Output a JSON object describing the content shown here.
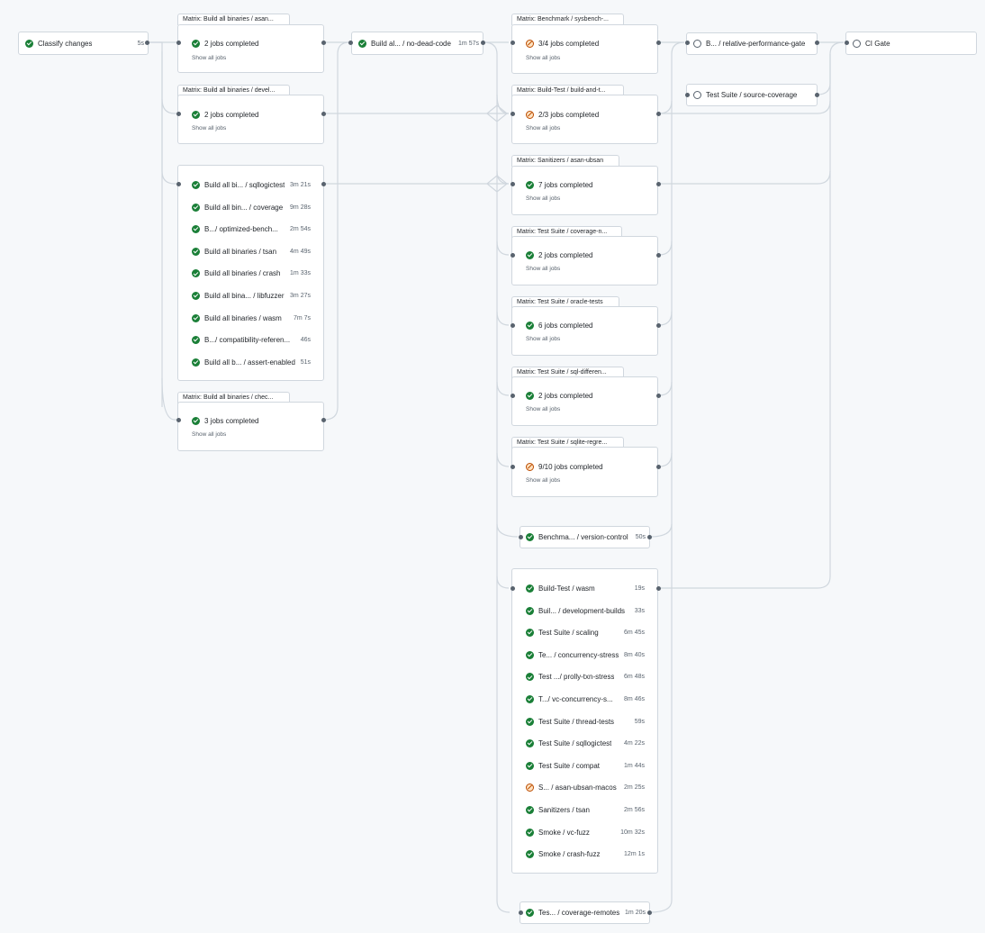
{
  "nodes": {
    "classify": {
      "label": "Classify changes",
      "duration": "5s"
    },
    "no_dead_code": {
      "label": "Build al... / no-dead-code",
      "duration": "1m 57s"
    },
    "perf_gate": {
      "label": "B... / relative-performance-gate"
    },
    "source_coverage": {
      "label": "Test Suite / source-coverage"
    },
    "ci_gate": {
      "label": "CI Gate"
    },
    "version_control": {
      "label": "Benchma... / version-control",
      "duration": "50s"
    },
    "coverage_remotes": {
      "label": "Tes... / coverage-remotes",
      "duration": "1m 20s"
    }
  },
  "show_all": "Show all jobs",
  "matrix": {
    "asan": {
      "tab": "Matrix: Build all binaries / asan...",
      "status": "2 jobs completed"
    },
    "devel": {
      "tab": "Matrix: Build all binaries / devel...",
      "status": "2 jobs completed"
    },
    "chec": {
      "tab": "Matrix: Build all binaries / chec...",
      "status": "3 jobs completed"
    },
    "sysbench": {
      "tab": "Matrix: Benchmark / sysbench-...",
      "status": "3/4 jobs completed"
    },
    "buildtest": {
      "tab": "Matrix: Build-Test / build-and-t...",
      "status": "2/3 jobs completed"
    },
    "sanitizers": {
      "tab": "Matrix: Sanitizers / asan-ubsan",
      "status": "7 jobs completed"
    },
    "coverage_n": {
      "tab": "Matrix: Test Suite / coverage-n...",
      "status": "2 jobs completed"
    },
    "oracle": {
      "tab": "Matrix: Test Suite / oracle-tests",
      "status": "6 jobs completed"
    },
    "sql_diff": {
      "tab": "Matrix: Test Suite / sql-differen...",
      "status": "2 jobs completed"
    },
    "sqlite": {
      "tab": "Matrix: Test Suite / sqlite-regre...",
      "status": "9/10 jobs completed"
    }
  },
  "build_list": [
    {
      "label": "Build all bi... / sqllogictest",
      "duration": "3m 21s"
    },
    {
      "label": "Build all bin...  / coverage",
      "duration": "9m 28s"
    },
    {
      "label": "B.../ optimized-bench...",
      "duration": "2m 54s"
    },
    {
      "label": "Build all binaries / tsan",
      "duration": "4m 49s"
    },
    {
      "label": "Build all binaries / crash",
      "duration": "1m 33s"
    },
    {
      "label": "Build all bina... / libfuzzer",
      "duration": "3m 27s"
    },
    {
      "label": "Build all binaries / wasm",
      "duration": "7m 7s"
    },
    {
      "label": "B.../ compatibility-referen...",
      "duration": "46s"
    },
    {
      "label": "Build all b... / assert-enabled",
      "duration": "51s"
    }
  ],
  "test_list": [
    {
      "label": "Build-Test / wasm",
      "duration": "19s",
      "status": "ok"
    },
    {
      "label": "Buil...  / development-builds",
      "duration": "33s",
      "status": "ok"
    },
    {
      "label": "Test Suite / scaling",
      "duration": "6m 45s",
      "status": "ok"
    },
    {
      "label": "Te... / concurrency-stress",
      "duration": "8m 40s",
      "status": "ok"
    },
    {
      "label": "Test .../ prolly-txn-stress",
      "duration": "6m 48s",
      "status": "ok"
    },
    {
      "label": "T.../ vc-concurrency-s...",
      "duration": "8m 46s",
      "status": "ok"
    },
    {
      "label": "Test Suite / thread-tests",
      "duration": "59s",
      "status": "ok"
    },
    {
      "label": "Test Suite / sqllogictest",
      "duration": "4m 22s",
      "status": "ok"
    },
    {
      "label": "Test Suite / compat",
      "duration": "1m 44s",
      "status": "ok"
    },
    {
      "label": "S...  / asan-ubsan-macos",
      "duration": "2m 25s",
      "status": "skip"
    },
    {
      "label": "Sanitizers / tsan",
      "duration": "2m 56s",
      "status": "ok"
    },
    {
      "label": "Smoke / vc-fuzz",
      "duration": "10m 32s",
      "status": "ok"
    },
    {
      "label": "Smoke / crash-fuzz",
      "duration": "12m 1s",
      "status": "ok"
    }
  ]
}
